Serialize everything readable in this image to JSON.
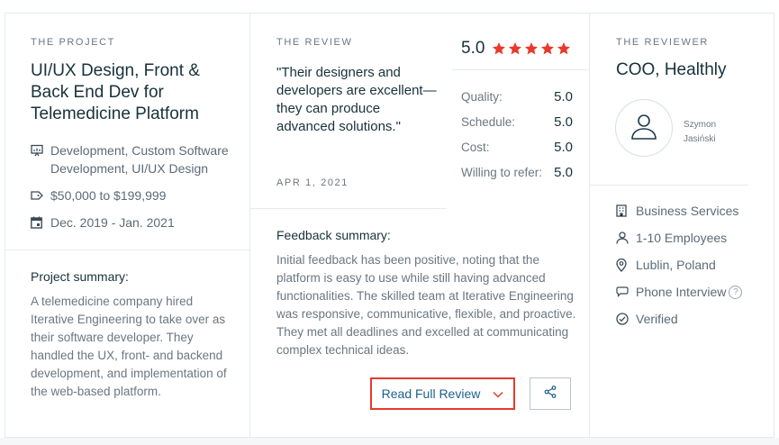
{
  "colors": {
    "accent_red": "#e8392b",
    "link_blue": "#1b5f8c",
    "text_dark": "#17313b",
    "text_muted": "#6b7780",
    "border": "#e2ebf0"
  },
  "project": {
    "eyebrow": "THE PROJECT",
    "title": "UI/UX Design, Front & Back End Dev for Telemedicine Platform",
    "services": "Development, Custom Software Development, UI/UX Design",
    "services_icon": "presentation-board-icon",
    "budget": "$50,000 to $199,999",
    "budget_icon": "price-tag-icon",
    "dates": "Dec. 2019 - Jan. 2021",
    "dates_icon": "calendar-icon",
    "summary_label": "Project summary:",
    "summary_text": "A telemedicine company hired Iterative Engineering to take over as their software developer. They handled the UX, front- and backend development, and implementation of the web-based platform."
  },
  "review": {
    "eyebrow": "THE REVIEW",
    "quote": "\"Their designers and developers are excellent— they can produce advanced solutions.\"",
    "date": "APR 1, 2021",
    "overall_rating": "5.0",
    "stars_filled": 5,
    "scores": [
      {
        "label": "Quality:",
        "value": "5.0"
      },
      {
        "label": "Schedule:",
        "value": "5.0"
      },
      {
        "label": "Cost:",
        "value": "5.0"
      },
      {
        "label": "Willing to refer:",
        "value": "5.0"
      }
    ],
    "feedback_label": "Feedback summary:",
    "feedback_text": "Initial feedback has been positive, noting that the platform is easy to use while still having advanced functionalities. The skilled team at Iterative Engineering was responsive, communicative, flexible, and proactive. They met all deadlines and excelled at communicating complex technical ideas.",
    "read_button": "Read Full Review",
    "read_button_icon": "chevron-down-icon",
    "share_icon": "share-icon"
  },
  "reviewer": {
    "eyebrow": "THE REVIEWER",
    "title": "COO, Healthly",
    "name_line1": "Szymon",
    "name_line2": "Jasiński",
    "avatar_icon": "user-icon",
    "industry": "Business Services",
    "industry_icon": "building-icon",
    "company_size": "1-10 Employees",
    "company_size_icon": "person-icon",
    "location": "Lublin, Poland",
    "location_icon": "map-pin-icon",
    "interview": "Phone Interview",
    "interview_icon": "chat-bubble-icon",
    "interview_help": "?",
    "verified": "Verified",
    "verified_icon": "check-circle-icon"
  }
}
